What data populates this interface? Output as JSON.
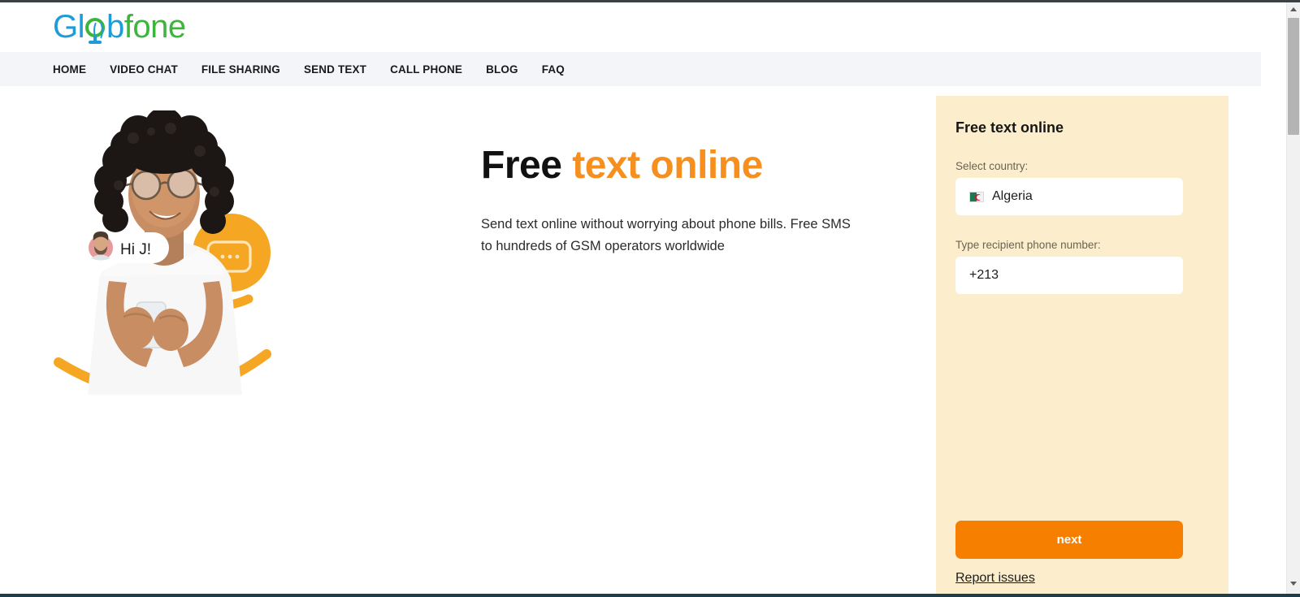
{
  "site": {
    "logo": {
      "part1": "Gl",
      "globe_letter": "o",
      "part2": "b",
      "part3": "fone",
      "full_text": "Globfone"
    }
  },
  "nav": {
    "items": [
      {
        "label": "HOME"
      },
      {
        "label": "VIDEO CHAT"
      },
      {
        "label": "FILE SHARING"
      },
      {
        "label": "SEND TEXT"
      },
      {
        "label": "CALL PHONE"
      },
      {
        "label": "BLOG"
      },
      {
        "label": "FAQ"
      }
    ]
  },
  "hero": {
    "headline_plain": "Free",
    "headline_accent": "text online",
    "subtitle": "Send text online without worrying about phone bills. Free SMS to hundreds of GSM operators worldwide",
    "illustration": {
      "bubble_text": "Hi J!",
      "avatar_name": "avatar-man",
      "chat_icon_name": "chat-bubble-icon"
    }
  },
  "panel": {
    "title": "Free text online",
    "country_label": "Select country:",
    "country_value": "Algeria",
    "country_flag": "flag-algeria",
    "phone_label": "Type recipient phone number:",
    "phone_value": "+213",
    "phone_placeholder": "+213",
    "next_label": "next",
    "report_label": "Report issues"
  },
  "colors": {
    "brand_blue": "#1f9bd8",
    "brand_green": "#3db53d",
    "accent_orange": "#f78f1e",
    "button_orange": "#f77f00",
    "panel_bg": "#fceecd",
    "navbar_bg": "#f4f5f9"
  }
}
